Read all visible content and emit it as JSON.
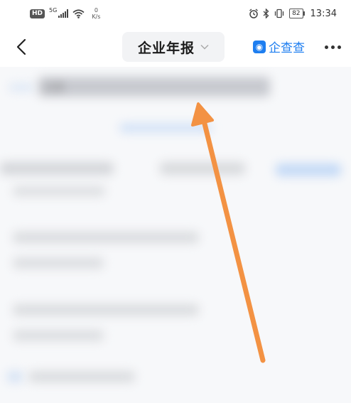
{
  "status_bar": {
    "hd": "HD",
    "network": "5G",
    "speed_value": "0",
    "speed_unit": "K/s",
    "battery": "82",
    "time": "13:34"
  },
  "nav": {
    "title": "企业年报",
    "brand": "企查查"
  },
  "colors": {
    "brand_blue": "#1e7ef0",
    "arrow_orange": "#f39243"
  },
  "content": {
    "blurred_company_name": "江西"
  }
}
